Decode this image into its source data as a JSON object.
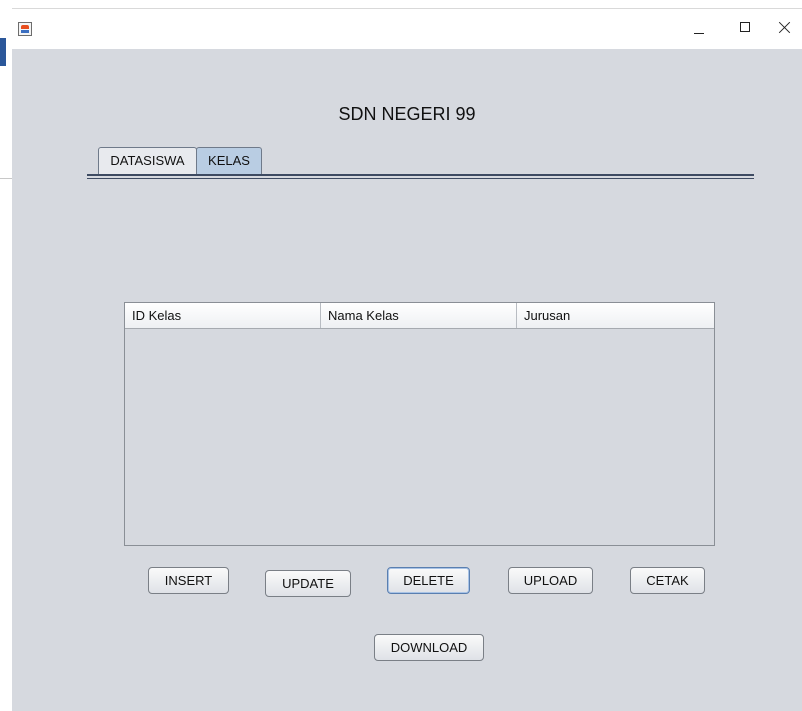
{
  "window": {
    "title": ""
  },
  "header": {
    "school_name": "SDN NEGERI 99"
  },
  "tabs": [
    {
      "label": "DATASISWA",
      "selected": false
    },
    {
      "label": "KELAS",
      "selected": true
    }
  ],
  "table": {
    "columns": [
      "ID Kelas",
      "Nama Kelas",
      "Jurusan"
    ],
    "rows": []
  },
  "buttons": {
    "insert": "INSERT",
    "update": "UPDATE",
    "delete": "DELETE",
    "upload": "UPLOAD",
    "cetak": "CETAK",
    "download": "DOWNLOAD"
  },
  "icons": {
    "app": "java-app-icon",
    "minimize": "minimize-icon",
    "maximize": "maximize-icon",
    "close": "close-icon"
  },
  "colors": {
    "window_bg": "#d6d9df",
    "selected_tab": "#b9cde3",
    "tab_rule": "#3e4b62"
  }
}
